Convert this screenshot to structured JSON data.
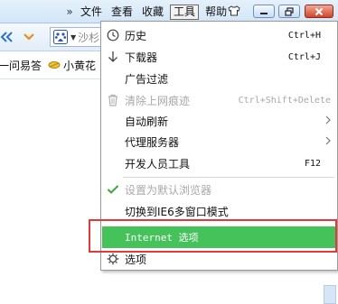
{
  "menubar": {
    "overflow": "»",
    "items": [
      "文件",
      "查看",
      "收藏",
      "工具",
      "帮助"
    ],
    "active_index": 3
  },
  "toolbar": {
    "search_placeholder": "沙杉"
  },
  "favorites": {
    "items": [
      "一问易答",
      "小黄花"
    ]
  },
  "tools_menu": {
    "items": [
      {
        "label": "历史",
        "shortcut": "Ctrl+H",
        "icon": "clock-icon",
        "enabled": true
      },
      {
        "label": "下载器",
        "shortcut": "Ctrl+J",
        "icon": "download-arrow-icon",
        "enabled": true
      },
      {
        "label": "广告过滤",
        "shortcut": "",
        "icon": "",
        "enabled": true
      },
      {
        "label": "清除上网痕迹",
        "shortcut": "Ctrl+Shift+Delete",
        "icon": "trash-icon",
        "enabled": false
      },
      {
        "label": "自动刷新",
        "submenu": true,
        "enabled": true
      },
      {
        "label": "代理服务器",
        "submenu": true,
        "enabled": true
      },
      {
        "label": "开发人员工具",
        "shortcut": "F12",
        "enabled": true
      },
      {
        "label": "设置为默认浏览器",
        "icon": "checkmark-icon",
        "enabled": false
      },
      {
        "label": "切换到IE6多窗口模式",
        "enabled": true
      },
      {
        "label": "Internet 选项",
        "enabled": true,
        "highlighted": true
      },
      {
        "label": "选项",
        "icon": "gear-icon",
        "enabled": true
      }
    ]
  },
  "colors": {
    "highlight": "#45c25a",
    "annotation": "#e23a3a",
    "check": "#3aa63a"
  }
}
